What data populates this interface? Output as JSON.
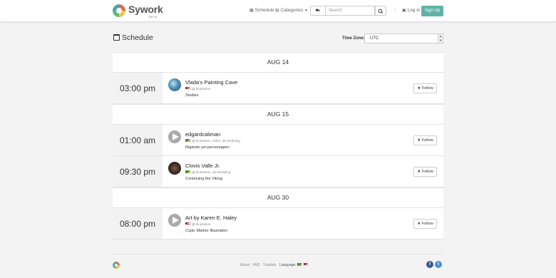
{
  "navbar": {
    "logo_text": "Sywork",
    "logo_badge": "BETA",
    "schedule_label": "Schedule",
    "categories_label": "Categories",
    "search_placeholder": "Search",
    "divider": "|",
    "login_label": "Log in",
    "signup_label": "Sign Up"
  },
  "page": {
    "title": "Schedule",
    "timezone_label": "Time Zone:",
    "timezone_value": "UTC"
  },
  "days": [
    {
      "date": "AUG 14",
      "events": [
        {
          "time": "03:00 pm",
          "name": "Vlada's Painting Cave",
          "categories": "Illustration",
          "description": "Studies",
          "follow_label": "Follow"
        }
      ]
    },
    {
      "date": "AUG 15",
      "events": [
        {
          "time": "01:00 am",
          "name": "edgardcaliman",
          "categories": "Illustration, Other, 3D Modeling",
          "description": "Rigando um personagem",
          "follow_label": "Follow"
        },
        {
          "time": "09:30 pm",
          "name": "Clovis Valle Jr.",
          "categories": "Illustration, 3D Modeling",
          "description": "Continuing the Viking",
          "follow_label": "Follow"
        }
      ]
    },
    {
      "date": "AUG 30",
      "events": [
        {
          "time": "08:00 pm",
          "name": "Art by Karen E. Haley",
          "categories": "Illustration",
          "description": "Copic Marker Illustration",
          "follow_label": "Follow"
        }
      ]
    }
  ],
  "footer": {
    "about": "About",
    "faq": "FAQ",
    "tutorials": "Tutorials",
    "separator": "·",
    "language_label": "Language:"
  },
  "icons": {
    "calendar": "calendar-icon",
    "folder": "folder-icon",
    "video": "video-camera-icon",
    "search": "search-icon",
    "lock": "lock-icon",
    "star": "star-icon",
    "facebook": "facebook-icon",
    "twitter": "twitter-icon"
  },
  "colors": {
    "accent": "#5fb3a6",
    "facebook": "#3b5998",
    "twitter": "#4a90d9"
  }
}
